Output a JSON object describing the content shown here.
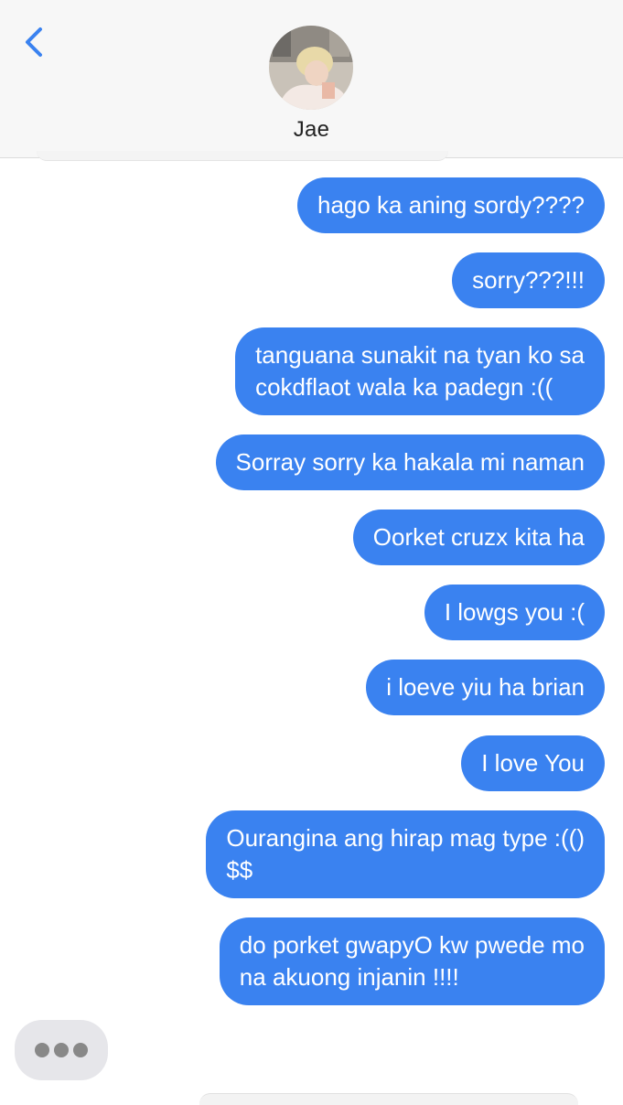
{
  "header": {
    "back_icon": "chevron-left-icon",
    "contact_name": "Jae"
  },
  "colors": {
    "sent_bubble": "#3a82f0",
    "typing_bubble": "#e6e6ea",
    "header_bg": "#f7f7f7",
    "back_chevron": "#3a82f0"
  },
  "messages": [
    {
      "text": "hago ka aning sordy????"
    },
    {
      "text": "sorry???!!!"
    },
    {
      "line1": "tanguana sunakit na tyan ko sa",
      "line2": "cokdflaot wala ka padegn :(("
    },
    {
      "text": "Sorray sorry ka hakala mi naman"
    },
    {
      "text": "Oorket cruzx kita ha"
    },
    {
      "text": "I lowgs you :("
    },
    {
      "text": "i loeve yiu ha brian"
    },
    {
      "text": "I love You"
    },
    {
      "line1": "Ourangina ang hirap mag type :(()",
      "line2": "$$"
    },
    {
      "line1": "do porket gwapyO kw pwede mo",
      "line2": "na akuong injanin !!!!"
    }
  ],
  "typing_indicator": {
    "icon": "typing-dots-icon"
  }
}
